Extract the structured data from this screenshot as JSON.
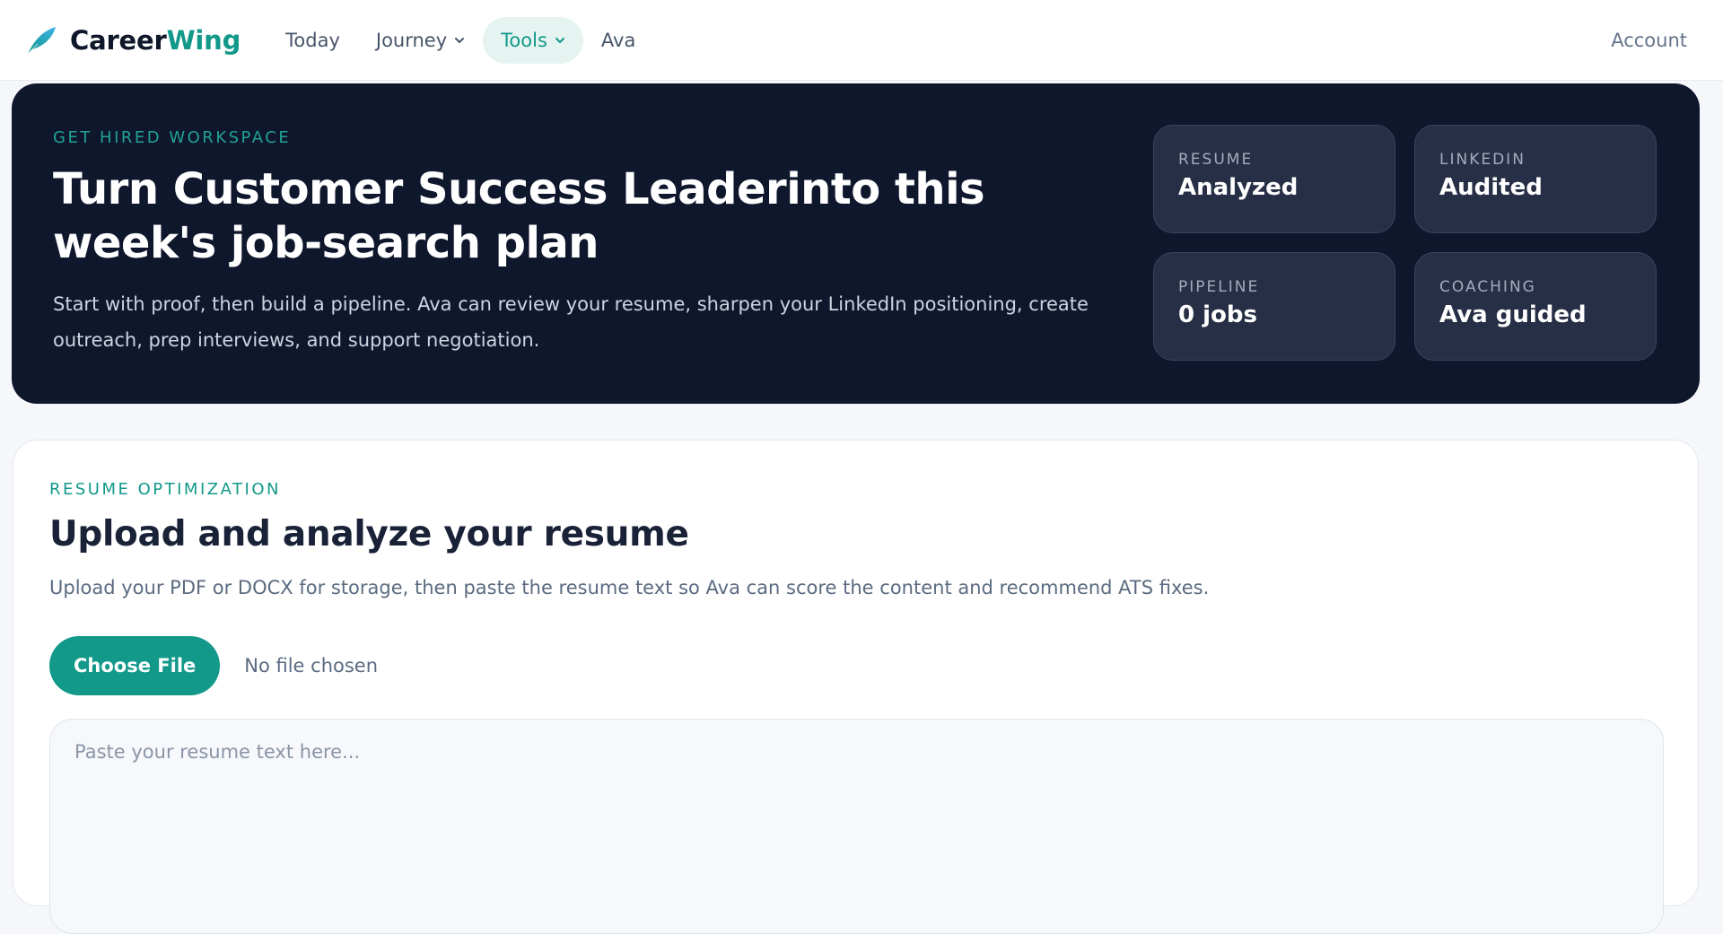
{
  "brand": {
    "name_part1": "Career",
    "name_part2": "Wing"
  },
  "nav": {
    "items": [
      {
        "label": "Today"
      },
      {
        "label": "Journey"
      },
      {
        "label": "Tools"
      },
      {
        "label": "Ava"
      }
    ],
    "active_item": "Tools",
    "account_label": "Account"
  },
  "hero": {
    "eyebrow": "GET HIRED WORKSPACE",
    "title": "Turn Customer Success Leaderinto this week's job-search plan",
    "subtitle": "Start with proof, then build a pipeline. Ava can review your resume, sharpen your LinkedIn positioning, create outreach, prep interviews, and support negotiation.",
    "stats": [
      {
        "label": "RESUME",
        "value": "Analyzed"
      },
      {
        "label": "LINKEDIN",
        "value": "Audited"
      },
      {
        "label": "PIPELINE",
        "value": "0 jobs"
      },
      {
        "label": "COACHING",
        "value": "Ava guided"
      }
    ]
  },
  "resume_card": {
    "eyebrow": "RESUME OPTIMIZATION",
    "title": "Upload and analyze your resume",
    "subtitle": "Upload your PDF or DOCX for storage, then paste the resume text so Ava can score the content and recommend ATS fixes.",
    "choose_file_label": "Choose File",
    "file_status": "No file chosen",
    "textarea_value": "",
    "textarea_placeholder": "Paste your resume text here..."
  },
  "colors": {
    "accent": "#12998a",
    "hero_bg": "#0f172d",
    "stat_bg": "#262f45",
    "nav_active_bg": "#e6f4f1"
  },
  "icons": {
    "brand": "feather-logo-icon",
    "dropdown": "chevron-down-icon"
  }
}
